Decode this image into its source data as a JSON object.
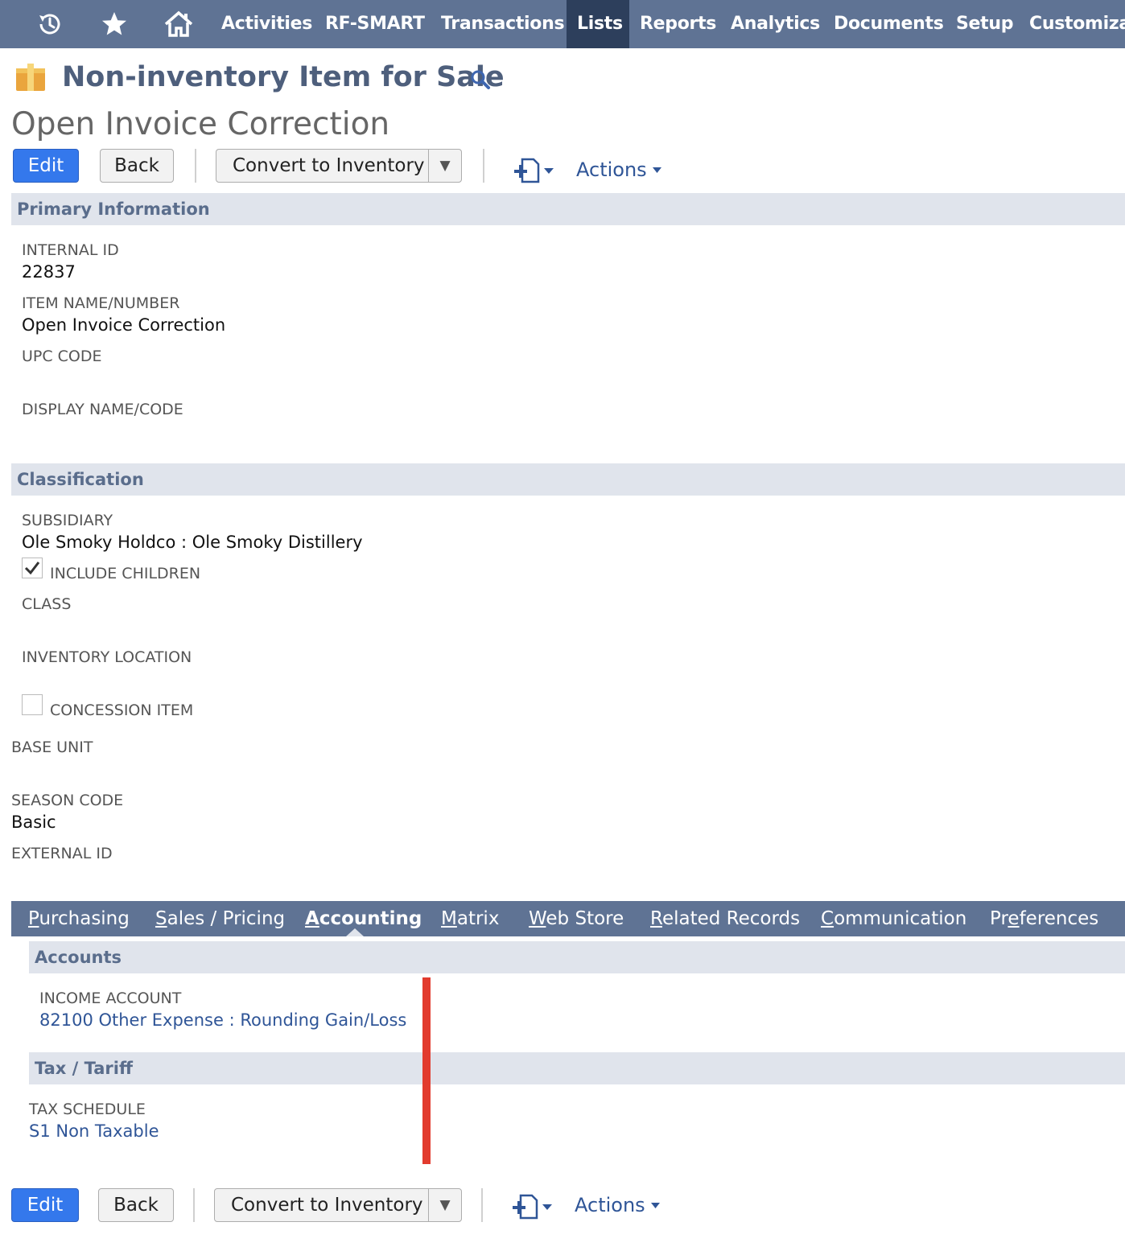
{
  "nav": {
    "icons": [
      "recent-icon",
      "star-icon",
      "home-icon"
    ],
    "items": [
      "Activities",
      "RF-SMART",
      "Transactions",
      "Lists",
      "Reports",
      "Analytics",
      "Documents",
      "Setup",
      "Customiza"
    ],
    "active": "Lists"
  },
  "header": {
    "record_type": "Non-inventory Item for Sale",
    "record_title": "Open Invoice Correction"
  },
  "toolbar": {
    "edit_label": "Edit",
    "back_label": "Back",
    "convert_label": "Convert to Inventory",
    "actions_label": "Actions"
  },
  "primary": {
    "heading": "Primary Information",
    "internal_id_label": "INTERNAL ID",
    "internal_id": "22837",
    "item_name_label": "ITEM NAME/NUMBER",
    "item_name": "Open Invoice Correction",
    "upc_label": "UPC CODE",
    "upc": "",
    "display_name_label": "DISPLAY NAME/CODE",
    "display_name": ""
  },
  "classification": {
    "heading": "Classification",
    "subsidiary_label": "SUBSIDIARY",
    "subsidiary": "Ole Smoky Holdco : Ole Smoky Distillery",
    "include_children_label": "INCLUDE CHILDREN",
    "include_children": true,
    "class_label": "CLASS",
    "class": "",
    "inventory_location_label": "INVENTORY LOCATION",
    "inventory_location": "",
    "concession_item_label": "CONCESSION ITEM",
    "concession_item": false,
    "base_unit_label": "BASE UNIT",
    "base_unit": "",
    "season_code_label": "SEASON CODE",
    "season_code": "Basic",
    "external_id_label": "EXTERNAL ID",
    "external_id": ""
  },
  "subtabs": {
    "items": [
      {
        "first": "P",
        "rest": "urchasing"
      },
      {
        "first": "S",
        "rest": "ales / Pricing"
      },
      {
        "first": "A",
        "rest": "ccounting"
      },
      {
        "first": "M",
        "rest": "atrix"
      },
      {
        "first": "W",
        "rest": "eb Store"
      },
      {
        "first": "R",
        "rest": "elated Records"
      },
      {
        "first": "C",
        "rest": "ommunication"
      },
      {
        "pre": "Pr",
        "first": "e",
        "rest": "ferences"
      }
    ],
    "active": "Accounting"
  },
  "accounting": {
    "accounts_heading": "Accounts",
    "income_account_label": "INCOME ACCOUNT",
    "income_account": "82100 Other Expense : Rounding Gain/Loss",
    "tax_heading": "Tax / Tariff",
    "tax_schedule_label": "TAX SCHEDULE",
    "tax_schedule": "S1 Non Taxable"
  },
  "colors": {
    "nav_bg": "#5f7394",
    "nav_active_bg": "#2d3f5c",
    "primary_button": "#3478ec",
    "link": "#2f5597",
    "section_bg": "#e0e4ec",
    "highlight_bar": "#e23b2e"
  }
}
